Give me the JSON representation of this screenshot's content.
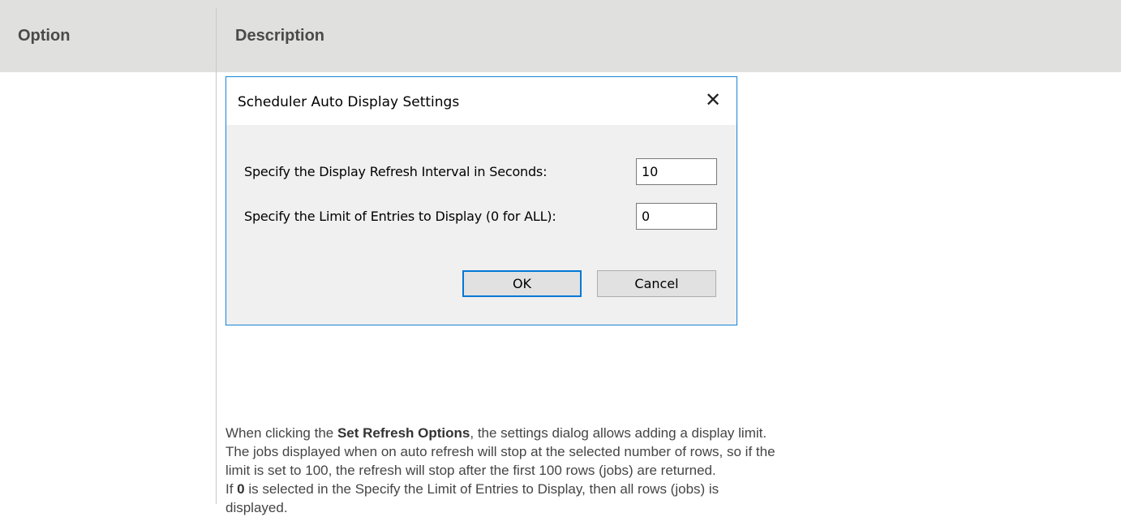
{
  "table": {
    "header_option": "Option",
    "header_description": "Description"
  },
  "dialog": {
    "title": "Scheduler Auto Display Settings",
    "close_glyph": "✕",
    "refresh_label": "Specify the Display Refresh Interval in Seconds:",
    "refresh_value": "10",
    "limit_label": "Specify the Limit of Entries to Display (0 for ALL):",
    "limit_value": "0",
    "ok_label": "OK",
    "cancel_label": "Cancel"
  },
  "description": {
    "line1_prefix": "When clicking the ",
    "line1_bold": "Set Refresh Options",
    "line1_suffix": ", the settings dialog allows adding a display limit.",
    "line2": "The jobs displayed when on auto refresh will stop at the selected number of rows, so if the",
    "line3": "limit is set to 100, the refresh will stop after the first 100 rows (jobs) are returned.",
    "line4_prefix": " If ",
    "line4_bold": "0",
    "line4_suffix": " is selected in the Specify the Limit of Entries to Display, then all rows (jobs) is",
    "line5": "displayed."
  },
  "colors": {
    "header_bg": "#e0e0df",
    "dialog_border": "#1883d7",
    "ok_border": "#0078d7"
  },
  "icons": {
    "close": "close-icon"
  }
}
